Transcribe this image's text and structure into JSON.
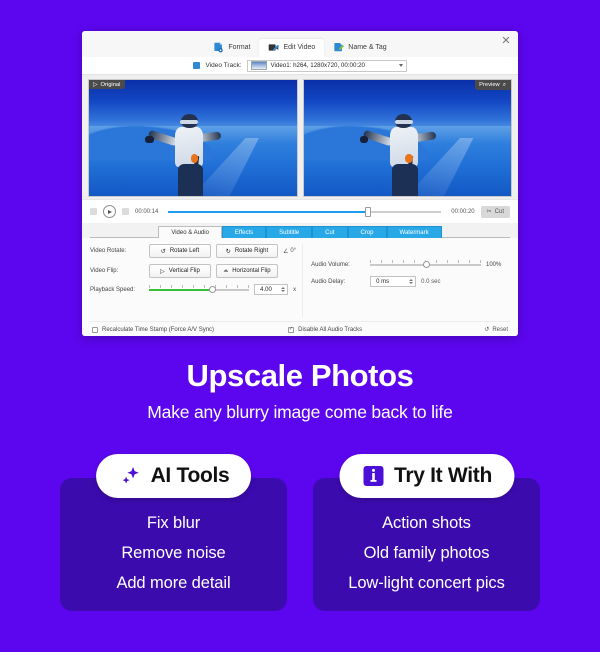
{
  "background_color": "#5C06EF",
  "app": {
    "close_label": "✕",
    "top_tabs": [
      {
        "label": "Format",
        "icon": "format-document-icon",
        "active": false
      },
      {
        "label": "Edit Video",
        "icon": "edit-video-icon",
        "active": true
      },
      {
        "label": "Name & Tag",
        "icon": "name-tag-icon",
        "active": false
      }
    ],
    "track": {
      "label": "Video Track:",
      "selected": "Video1: h264, 1280x720, 00:00:20"
    },
    "panes": {
      "original_label": "Original",
      "preview_label": "Preview"
    },
    "timeline": {
      "current_time": "00:00:14",
      "total_time": "00:00:20",
      "cut_label": "Cut",
      "progress_percent": 72
    },
    "sub_tabs": [
      {
        "label": "Video & Audio",
        "active": true
      },
      {
        "label": "Effects",
        "active": false
      },
      {
        "label": "Subtitle",
        "active": false
      },
      {
        "label": "Cut",
        "active": false
      },
      {
        "label": "Crop",
        "active": false
      },
      {
        "label": "Watermark",
        "active": false
      }
    ],
    "settings": {
      "video_rotate_label": "Video Rotate:",
      "rotate_left_label": "Rotate Left",
      "rotate_right_label": "Rotate Right",
      "angle_value": "0°",
      "video_flip_label": "Video Flip:",
      "vertical_flip_label": "Vertical Flip",
      "horizontal_flip_label": "Horizontal Flip",
      "playback_speed_label": "Playback Speed:",
      "playback_speed_value": "4.00",
      "playback_speed_unit": "x",
      "playback_speed_percent": 62,
      "audio_volume_label": "Audio Volume:",
      "audio_volume_value": "100%",
      "audio_volume_percent": 50,
      "audio_delay_label": "Audio Delay:",
      "audio_delay_value": "0 ms",
      "audio_delay_seconds": "0.0 sec",
      "recalculate_label": "Recalculate Time Stamp (Force A/V Sync)",
      "recalculate_checked": false,
      "disable_audio_label": "Disable All Audio Tracks",
      "disable_audio_checked": true,
      "reset_label": "Reset"
    }
  },
  "hero": {
    "headline": "Upscale Photos",
    "subheadline": "Make any blurry image come back to life"
  },
  "cards": [
    {
      "title": "AI Tools",
      "icon": "sparkle-icon",
      "items": [
        "Fix blur",
        "Remove noise",
        "Add more detail"
      ]
    },
    {
      "title": "Try It With",
      "icon": "info-icon",
      "items": [
        "Action shots",
        "Old family photos",
        "Low-light concert pics"
      ]
    }
  ],
  "colors": {
    "page_purple": "#5C06EF",
    "card_purple": "#3C0BAE",
    "accent_blue": "#29A8E8",
    "timeline_blue": "#1F9CF0",
    "speed_green": "#39C13B"
  }
}
